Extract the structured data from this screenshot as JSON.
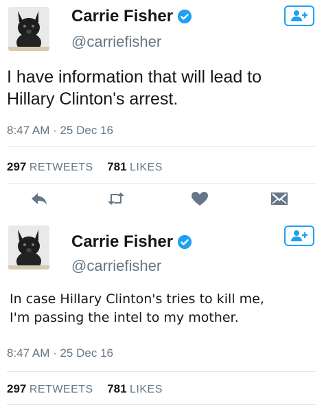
{
  "tweets": [
    {
      "display_name": "Carrie Fisher",
      "handle": "@carriefisher",
      "text": "I have information that will lead to Hillary Clinton's arrest.",
      "timestamp": "8:47 AM · 25 Dec 16",
      "retweets_count": "297",
      "retweets_label": "RETWEETS",
      "likes_count": "781",
      "likes_label": "LIKES"
    },
    {
      "display_name": "Carrie Fisher",
      "handle": "@carriefisher",
      "text_line1": "In case Hillary Clinton's tries to kill me,",
      "text_line2": "I'm passing the intel to my mother.",
      "timestamp": "8:47 AM · 25 Dec 16",
      "retweets_count": "297",
      "retweets_label": "RETWEETS",
      "likes_count": "781",
      "likes_label": "LIKES"
    }
  ],
  "icons": {
    "verified": "verified-badge-icon",
    "follow": "follow-user-icon",
    "reply": "reply-icon",
    "retweet": "retweet-icon",
    "like": "heart-icon",
    "message": "direct-message-icon"
  },
  "colors": {
    "accent": "#1da1f2",
    "text": "#14171a",
    "muted": "#657786",
    "divider": "#e1e8ed"
  }
}
